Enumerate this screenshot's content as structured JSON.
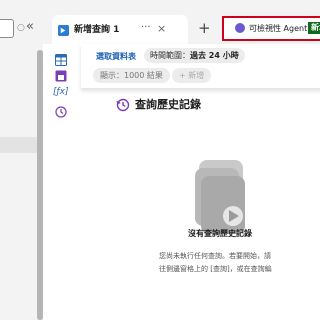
{
  "tab": {
    "label": "新增查詢 1",
    "more": "···",
    "close": "×",
    "add": "+"
  },
  "agent": {
    "label": "可檢視性 Agent",
    "badge": "新增"
  },
  "query": {
    "select_table": "選取資料表",
    "time_range_label": "時間範圍：",
    "time_range_value": "過去 24 小時",
    "show_results": "顯示：1000 結果",
    "add_filter": "+ 新增"
  },
  "history": {
    "title": "查詢歷史記錄"
  },
  "empty": {
    "title": "沒有查詢歷史記錄",
    "desc_line1": "您尚未執行任何查詢。若要開始，請",
    "desc_line2": "往側邊窗格上的 [查詢]，或在查詢編"
  },
  "left": {
    "dot_icon": "○",
    "collapse": "«"
  },
  "rail": {
    "fx_label": "[ƒx]"
  },
  "colors": {
    "accent": "#1a5fb4",
    "highlight_border": "#d0021b",
    "badge_bg": "#0f6b1c"
  },
  "icons": [
    "tab-query-icon",
    "table-icon",
    "function-icon",
    "history-icon",
    "agent-icon"
  ]
}
